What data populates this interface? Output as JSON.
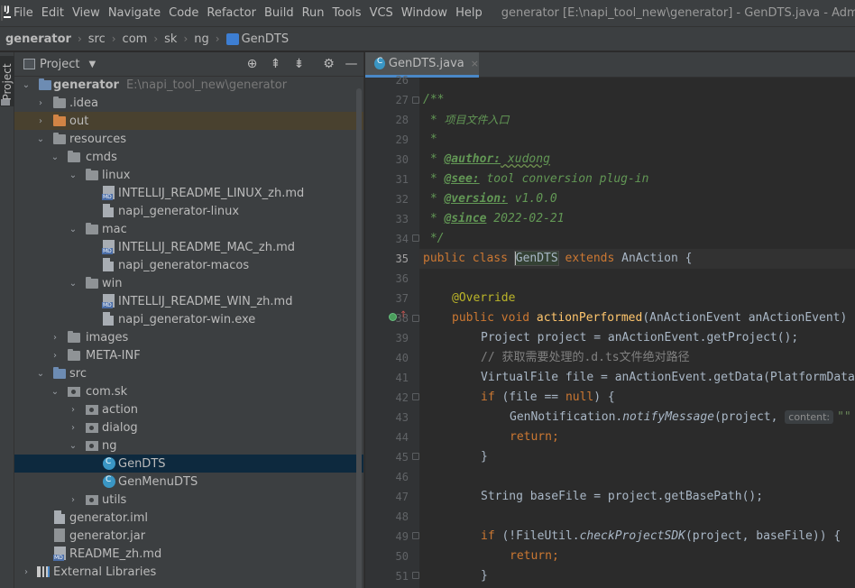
{
  "menubar": {
    "items": [
      "File",
      "Edit",
      "View",
      "Navigate",
      "Code",
      "Refactor",
      "Build",
      "Run",
      "Tools",
      "VCS",
      "Window",
      "Help"
    ],
    "title": "generator [E:\\napi_tool_new\\generator] - GenDTS.java - Administ"
  },
  "breadcrumb": [
    "generator",
    "src",
    "com",
    "sk",
    "ng",
    "GenDTS"
  ],
  "toolstrip": {
    "label": "Project"
  },
  "project_panel": {
    "title": "Project",
    "tree": [
      {
        "label": "generator",
        "hint": "E:\\napi_tool_new\\generator"
      },
      {
        "label": ".idea"
      },
      {
        "label": "out"
      },
      {
        "label": "resources"
      },
      {
        "label": "cmds"
      },
      {
        "label": "linux"
      },
      {
        "label": "INTELLIJ_README_LINUX_zh.md"
      },
      {
        "label": "napi_generator-linux"
      },
      {
        "label": "mac"
      },
      {
        "label": "INTELLIJ_README_MAC_zh.md"
      },
      {
        "label": "napi_generator-macos"
      },
      {
        "label": "win"
      },
      {
        "label": "INTELLIJ_README_WIN_zh.md"
      },
      {
        "label": "napi_generator-win.exe"
      },
      {
        "label": "images"
      },
      {
        "label": "META-INF"
      },
      {
        "label": "src"
      },
      {
        "label": "com.sk"
      },
      {
        "label": "action"
      },
      {
        "label": "dialog"
      },
      {
        "label": "ng"
      },
      {
        "label": "GenDTS"
      },
      {
        "label": "GenMenuDTS"
      },
      {
        "label": "utils"
      },
      {
        "label": "generator.iml"
      },
      {
        "label": "generator.jar"
      },
      {
        "label": "README_zh.md"
      },
      {
        "label": "External Libraries"
      }
    ]
  },
  "editor": {
    "tab": {
      "label": "GenDTS.java",
      "close": "×"
    },
    "line_numbers": [
      "26",
      "27",
      "28",
      "29",
      "30",
      "31",
      "32",
      "33",
      "34",
      "35",
      "36",
      "37",
      "38",
      "39",
      "40",
      "41",
      "42",
      "43",
      "44",
      "45",
      "46",
      "47",
      "48",
      "49",
      "50",
      "51"
    ],
    "code": {
      "l27": "/**",
      "l28_star": " * ",
      "l28_text": "项目文件入口",
      "l29": " *",
      "l30_star": " * ",
      "l30_tag": "@author:",
      "l30_val": " xudong",
      "l31_star": " * ",
      "l31_tag": "@see:",
      "l31_val": " tool conversion plug-in",
      "l32_star": " * ",
      "l32_tag": "@version:",
      "l32_val": " v1.0.0",
      "l33_star": " * ",
      "l33_tag": "@since",
      "l33_val": " 2022-02-21",
      "l34": " */",
      "l35_kw1": "public class ",
      "l35_name": "GenDTS",
      "l35_kw2": " extends ",
      "l35_rest": "AnAction {",
      "l37_ann": "@Override",
      "l38_kw": "public void ",
      "l38_fn": "actionPerformed",
      "l38_rest": "(AnActionEvent anActionEvent) {",
      "l39": "Project project = anActionEvent.getProject();",
      "l40": "// 获取需要处理的.d.ts文件绝对路径",
      "l41": "VirtualFile file = anActionEvent.getData(PlatformDataKeys.VIRTUAL_FILE);",
      "l42_kw": "if ",
      "l42_a": "(file == ",
      "l42_null": "null",
      "l42_b": ") {",
      "l43_cls": "GenNotification.",
      "l43_fn": "notifyMessage",
      "l43_a": "(project, ",
      "l43_hint": "content:",
      "l43_str": "\"\"",
      "l44_kw": "return",
      "l44_semi": ";",
      "l45": "}",
      "l47": "String baseFile = project.getBasePath();",
      "l49_kw": "if ",
      "l49_a": "(!FileUtil.",
      "l49_fn": "checkProjectSDK",
      "l49_b": "(project, baseFile)) {",
      "l50_kw": "return",
      "l50_semi": ";",
      "l51": "}"
    }
  }
}
